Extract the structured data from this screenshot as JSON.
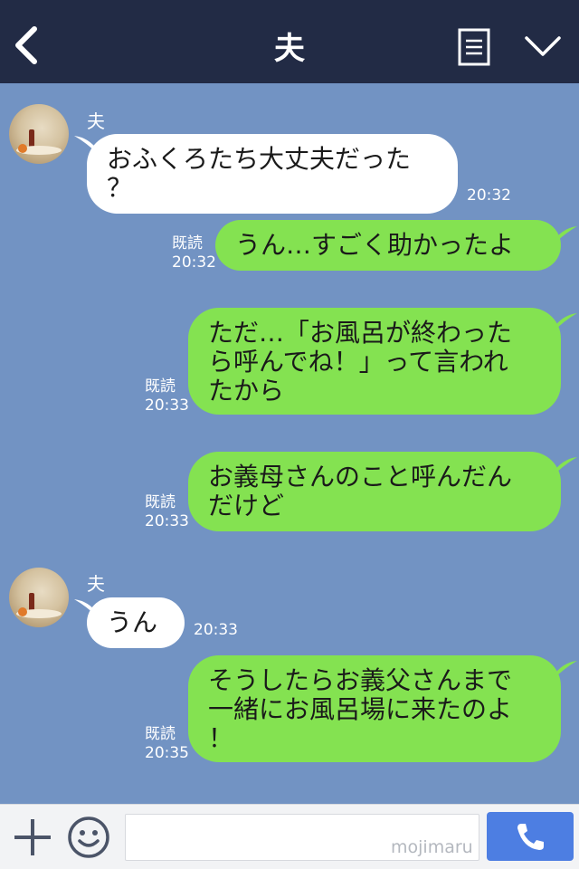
{
  "header": {
    "title": "夫",
    "back_icon": "chevron-left-icon",
    "menu_icon": "list-icon",
    "collapse_icon": "chevron-down-icon",
    "background": "#222b45"
  },
  "chat": {
    "background": "#7293c3",
    "incoming_bubble_color": "#ffffff",
    "outgoing_bubble_color": "#84e251",
    "messages": [
      {
        "direction": "in",
        "sender": "夫",
        "text": "おふくろたち大丈夫だった\n？",
        "time": "20:32"
      },
      {
        "direction": "out",
        "read": "既読",
        "text": "うん…すごく助かったよ",
        "time": "20:32"
      },
      {
        "direction": "out",
        "read": "既読",
        "text": "ただ…「お風呂が終わった\nら呼んでね！」って言われ\nたから",
        "time": "20:33"
      },
      {
        "direction": "out",
        "read": "既読",
        "text": "お義母さんのこと呼んだん\nだけど",
        "time": "20:33"
      },
      {
        "direction": "in",
        "sender": "夫",
        "text": "うん",
        "time": "20:33"
      },
      {
        "direction": "out",
        "read": "既読",
        "text": "そうしたらお義父さんまで\n一緒にお風呂場に来たのよ\n！",
        "time": "20:35"
      }
    ]
  },
  "footer": {
    "plus_icon": "plus-icon",
    "emoji_icon": "smiley-icon",
    "input_value": "",
    "watermark": "mojimaru",
    "send_icon": "phone-icon",
    "send_color": "#4d7ee2"
  }
}
